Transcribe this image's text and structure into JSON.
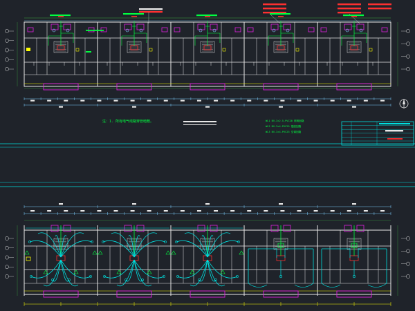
{
  "colors": {
    "background": "#1f232a",
    "wall": "#e8e8e8",
    "grid": "#3ea63e",
    "dimension": "#7fd0ff",
    "partition": "#e020e0",
    "circuit": "#00e0e0",
    "fixture": "#ff3030",
    "label": "#00ff40",
    "highlight": "#ffff00",
    "titleblock": "#00e0e0"
  },
  "plan_top": {
    "note": "注：1. 所有电气线路穿管暗敷。",
    "annotations": [
      "WL1",
      "WL2",
      "WL3",
      "WL4",
      "WL5"
    ],
    "callouts": [
      "BV-3×2.5-PVC20",
      "BV-3×4-PVC25"
    ],
    "legend_lines": [
      "WL1 BV-3×2.5-PVC20 照明回路",
      "WL2 BV-3×4-PVC25 插座回路",
      "WL3 BV-3×4-PVC25 空调回路"
    ]
  },
  "plan_bottom": {
    "annotations": [
      "AL1",
      "AL2",
      "AL3",
      "AL4",
      "AL5"
    ]
  },
  "compass": {
    "icon": "north-arrow-icon"
  },
  "title_block": {
    "rows": 6
  }
}
